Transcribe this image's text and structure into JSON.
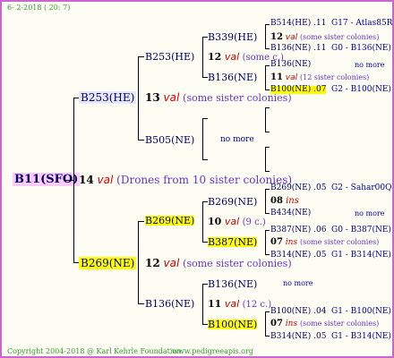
{
  "header": {
    "date": "6- 2-2018 ( 20: 7)"
  },
  "footer": {
    "copyright": "Copyright 2004-2018 @ Karl Kehrle Foundation.",
    "site": "www.pedigreeapis.org"
  },
  "colors": {
    "border": "#cc66cc",
    "highlight": "#ffff00",
    "root_bg": "#ffccff",
    "val": "#cc0000"
  },
  "root": {
    "name": "B11(SFO)",
    "num": "14",
    "val": "val",
    "note": "(Drones from 10 sister colonies)"
  },
  "gen1": {
    "top": {
      "name": "B253(HE)",
      "num": "13",
      "val": "val",
      "note": "(some sister colonies)"
    },
    "bottom": {
      "name": "B269(NE)",
      "num": "12",
      "val": "val",
      "note": "(some sister colonies)"
    }
  },
  "gen2": {
    "a": {
      "name": "B253(HE)",
      "num": "12",
      "val": "val",
      "note": "(some c.)"
    },
    "b": {
      "name": "B505(NE)",
      "nomore": "no more"
    },
    "c": {
      "name": "B269(NE)",
      "num": "10",
      "val": "val",
      "note": "(9 c.)"
    },
    "d": {
      "name": "B136(NE)",
      "num": "11",
      "val": "val",
      "note": "(12 c.)"
    }
  },
  "gen3": {
    "a1": {
      "name": "B339(HE)",
      "num": "12",
      "val": "val",
      "note": "(some sister colonies)"
    },
    "a2": {
      "name": "B136(NE)",
      "num": "11",
      "val": "val",
      "note": "(12 sister colonies)"
    },
    "c1": {
      "name": "B269(NE)",
      "num": "08",
      "ins": "ins"
    },
    "c2": {
      "name": "B387(NE)",
      "num": "07",
      "ins": "ins",
      "note": "(some sister colonies)"
    },
    "d1": {
      "name": "B136(NE)",
      "nomore": "no more"
    },
    "d2": {
      "name": "B100(NE)",
      "num": "07",
      "ins": "ins",
      "note": "(some sister colonies)"
    }
  },
  "gen4": [
    {
      "name": "B514(HE)",
      "n": ".11",
      "code": "G17 - Atlas85R"
    },
    {
      "name": "B136(NE)",
      "n": ".11",
      "code": "G0 - B136(NE)"
    },
    {
      "name": "B136(NE)",
      "n": "",
      "code": "no more"
    },
    {
      "name": "B100(NE)",
      "n": ".07",
      "code": "G2 - B100(NE)"
    },
    {
      "name": "B269(NE)",
      "n": ".05",
      "code": "G2 - Sahar00Q"
    },
    {
      "name": "B434(NE)",
      "n": "",
      "code": "no more"
    },
    {
      "name": "B387(NE)",
      "n": ".06",
      "code": "G0 - B387(NE)"
    },
    {
      "name": "B314(NE)",
      "n": ".05",
      "code": "G1 - B314(NE)"
    },
    {
      "name": "B100(NE)",
      "n": ".04",
      "code": "G1 - B100(NE)"
    },
    {
      "name": "B314(NE)",
      "n": ".05",
      "code": "G1 - B314(NE)"
    }
  ]
}
